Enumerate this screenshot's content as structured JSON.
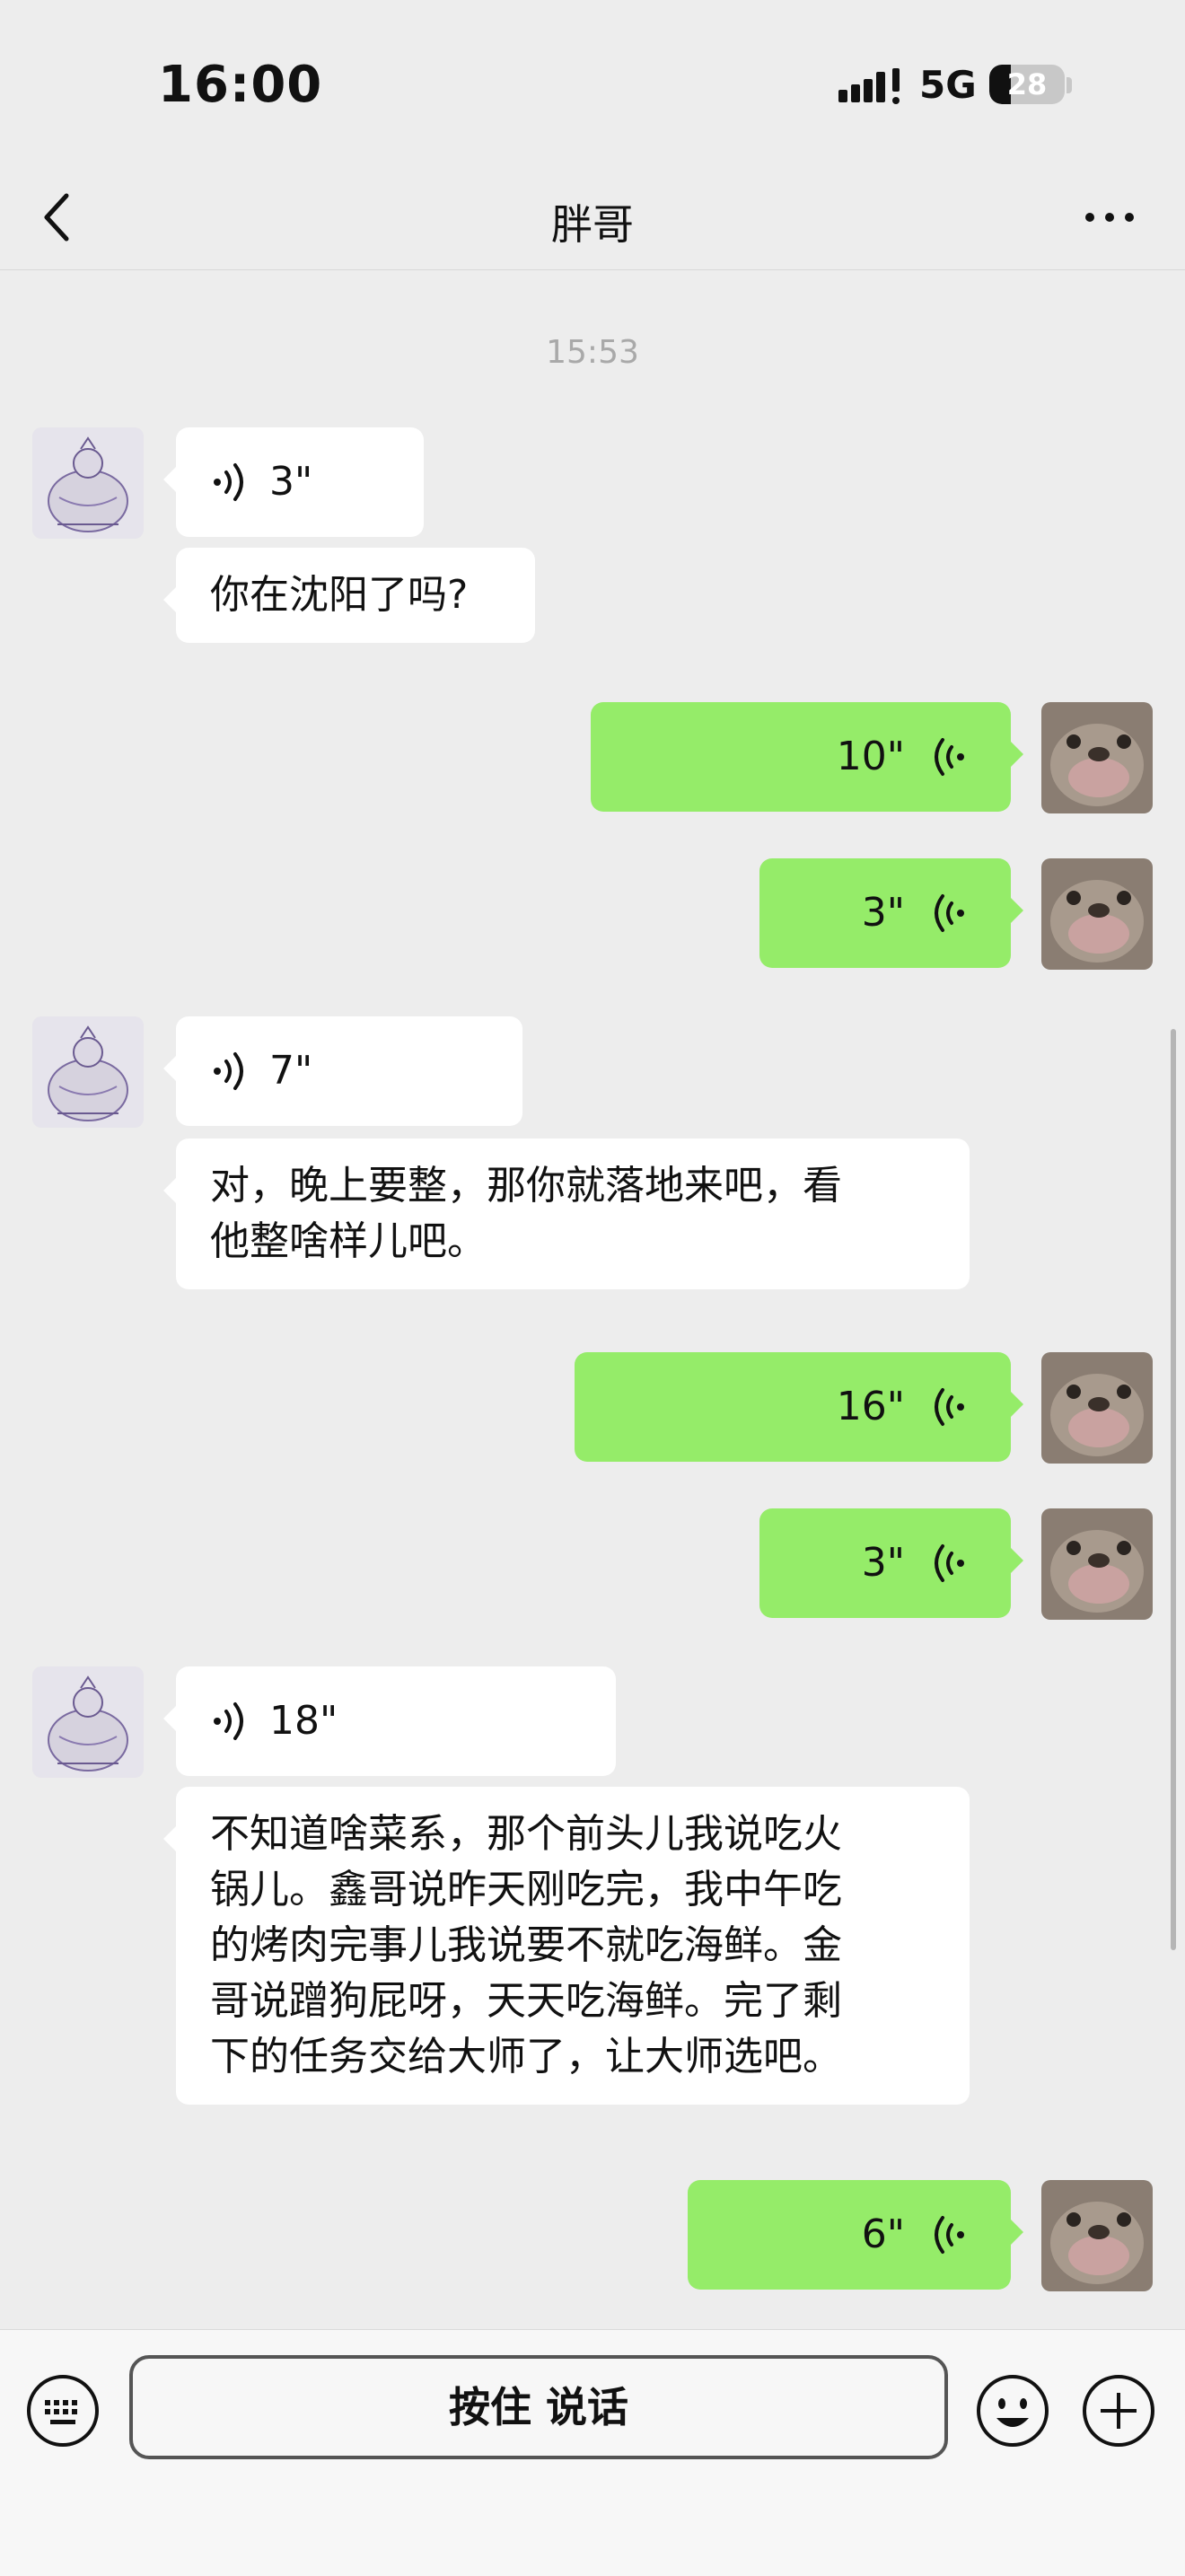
{
  "status_bar": {
    "time": "16:00",
    "network": "5G",
    "battery": "28",
    "battery_level": 0.28
  },
  "nav": {
    "title": "胖哥"
  },
  "timestamp": "15:53",
  "messages": [
    {
      "side": "in",
      "type": "voice",
      "duration": "3\""
    },
    {
      "side": "in",
      "type": "text",
      "lines": [
        "你在沈阳了吗?"
      ]
    },
    {
      "side": "out",
      "type": "voice",
      "duration": "10\""
    },
    {
      "side": "out",
      "type": "voice",
      "duration": "3\""
    },
    {
      "side": "in",
      "type": "voice",
      "duration": "7\""
    },
    {
      "side": "in",
      "type": "text",
      "lines": [
        "对，晚上要整，那你就落地来吧，看",
        "他整啥样儿吧。"
      ]
    },
    {
      "side": "out",
      "type": "voice",
      "duration": "16\""
    },
    {
      "side": "out",
      "type": "voice",
      "duration": "3\""
    },
    {
      "side": "in",
      "type": "voice",
      "duration": "18\""
    },
    {
      "side": "in",
      "type": "text",
      "lines": [
        "不知道啥菜系，那个前头儿我说吃火",
        "锅儿。鑫哥说昨天刚吃完，我中午吃",
        "的烤肉完事儿我说要不就吃海鲜。金",
        "哥说蹭狗屁呀，天天吃海鲜。完了剩",
        "下的任务交给大师了，让大师选吧。"
      ]
    },
    {
      "side": "out",
      "type": "voice",
      "duration": "6\""
    }
  ],
  "input_bar": {
    "talk_label": "按住 说话"
  },
  "colors": {
    "out_bubble": "#95ec69",
    "in_bubble": "#ffffff",
    "background": "#ededed"
  },
  "icons": {
    "back": "chevron-left-icon",
    "more": "more-dots-icon",
    "keyboard": "keyboard-icon",
    "emoji": "emoji-icon",
    "plus": "plus-icon"
  }
}
